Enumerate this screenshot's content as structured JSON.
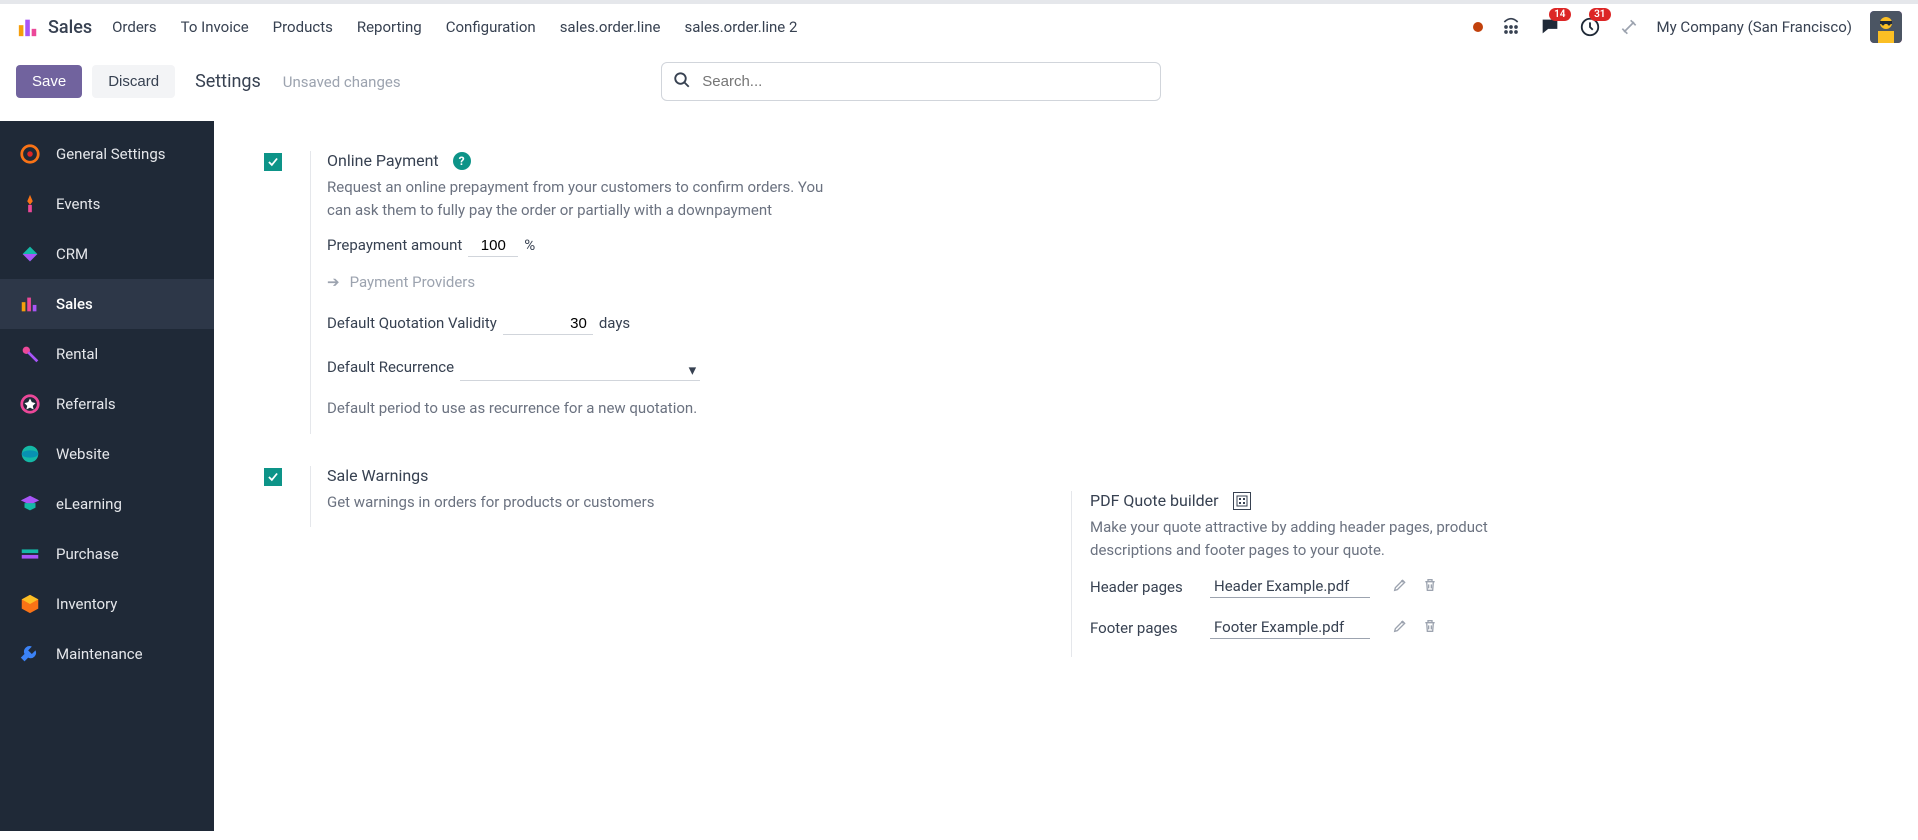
{
  "navbar": {
    "app_title": "Sales",
    "links": [
      "Orders",
      "To Invoice",
      "Products",
      "Reporting",
      "Configuration",
      "sales.order.line",
      "sales.order.line 2"
    ],
    "messages_badge": "14",
    "activities_badge": "31",
    "company": "My Company (San Francisco)"
  },
  "actionbar": {
    "save": "Save",
    "discard": "Discard",
    "title": "Settings",
    "unsaved": "Unsaved changes",
    "search_placeholder": "Search..."
  },
  "sidebar": {
    "items": [
      {
        "label": "General Settings"
      },
      {
        "label": "Events"
      },
      {
        "label": "CRM"
      },
      {
        "label": "Sales"
      },
      {
        "label": "Rental"
      },
      {
        "label": "Referrals"
      },
      {
        "label": "Website"
      },
      {
        "label": "eLearning"
      },
      {
        "label": "Purchase"
      },
      {
        "label": "Inventory"
      },
      {
        "label": "Maintenance"
      }
    ]
  },
  "settings": {
    "online_payment": {
      "title": "Online Payment",
      "desc": "Request an online prepayment from your customers to confirm orders. You can ask them to fully pay the order or partially with a downpayment",
      "prepay_label": "Prepayment amount",
      "prepay_value": "100",
      "prepay_suffix": "%",
      "providers_link": "Payment Providers",
      "validity_label": "Default Quotation Validity",
      "validity_value": "30",
      "validity_suffix": "days",
      "recurrence_label": "Default Recurrence",
      "recurrence_value": "",
      "recurrence_desc": "Default period to use as recurrence for a new quotation."
    },
    "sale_warnings": {
      "title": "Sale Warnings",
      "desc": "Get warnings in orders for products or customers"
    },
    "pdf_builder": {
      "title": "PDF Quote builder",
      "desc": "Make your quote attractive by adding header pages, product descriptions and footer pages to your quote.",
      "header_label": "Header pages",
      "header_file": "Header Example.pdf",
      "footer_label": "Footer pages",
      "footer_file": "Footer Example.pdf"
    }
  }
}
